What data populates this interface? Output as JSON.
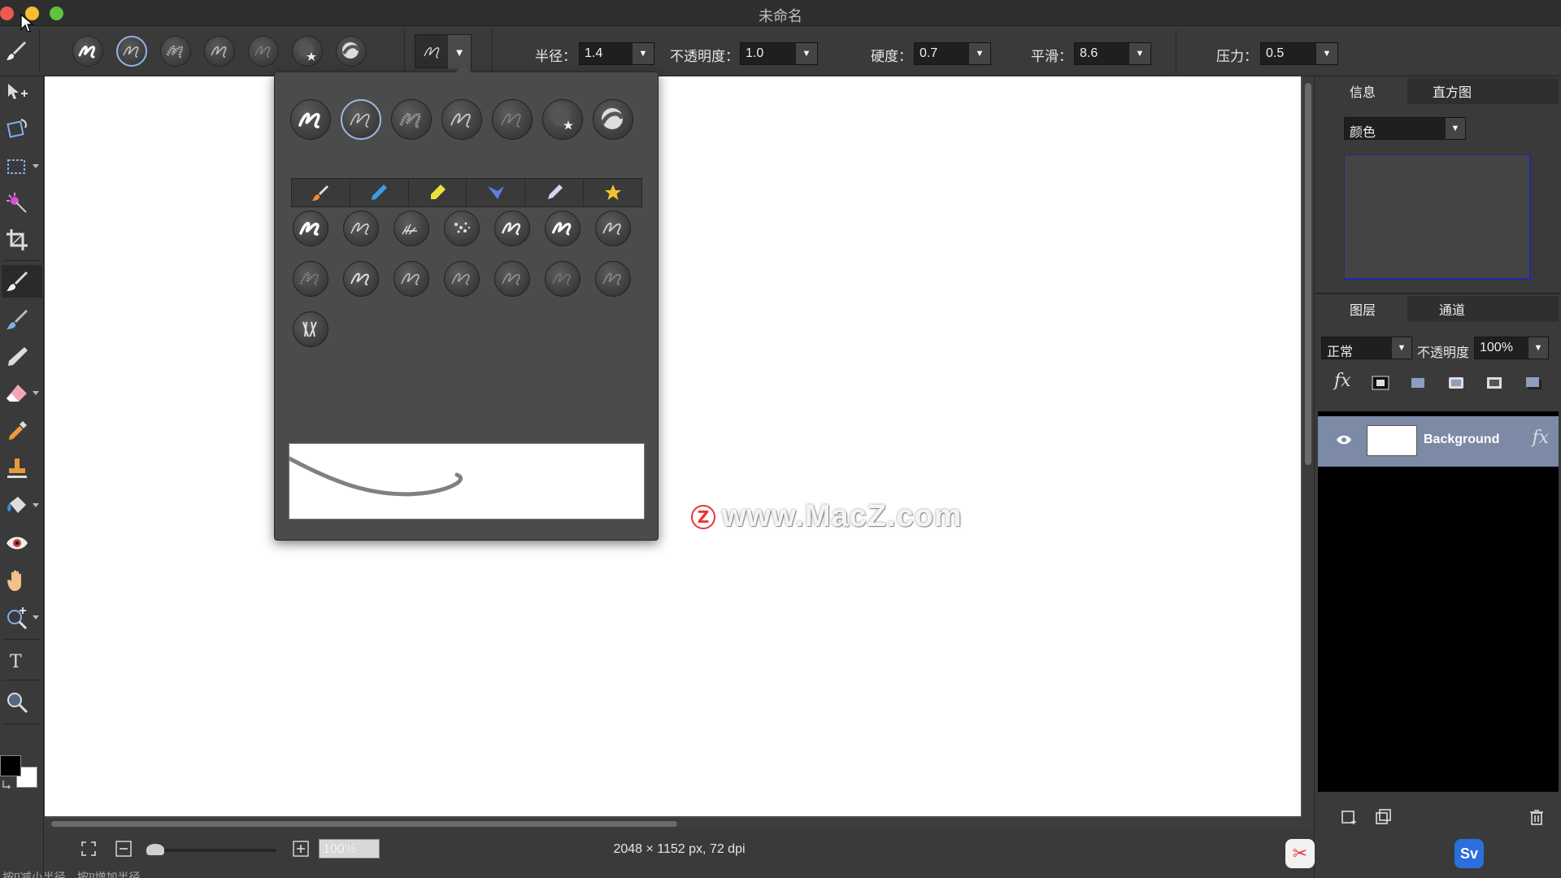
{
  "window": {
    "title": "未命名"
  },
  "options": {
    "radius_label": "半径：",
    "radius_value": "1.4",
    "opacity_label": "不透明度：",
    "opacity_value": "1.0",
    "hardness_label": "硬度：",
    "hardness_value": "0.7",
    "smooth_label": "平滑：",
    "smooth_value": "8.6",
    "pressure_label": "压力：",
    "pressure_value": "0.5"
  },
  "right_panel": {
    "tabs_top": [
      "信息",
      "直方图"
    ],
    "histogram_channel": "颜色",
    "tabs_layers": [
      "图层",
      "通道"
    ],
    "blend_mode": "正常",
    "layer_opacity_label": "不透明度",
    "layer_opacity_value": "100%",
    "fx_label": "fx",
    "layers": [
      {
        "name": "Background"
      }
    ]
  },
  "status": {
    "zoom_value": "100%",
    "dimensions": "2048 × 1152 px, 72 dpi",
    "hint": "按[]减小半径，按]]增加半径"
  },
  "watermark": {
    "text": "www.MacZ.com",
    "logo_letter": "Z"
  },
  "colors": {
    "accent_selection": "#8fb4e6",
    "layer_selected": "#7c8aa6",
    "foreground": "#000000",
    "background": "#ffffff",
    "close": "#ee5a52",
    "minimize": "#f5bd2f",
    "maximize": "#5fc33f"
  },
  "app_badges": [
    "✂",
    "Sv"
  ]
}
